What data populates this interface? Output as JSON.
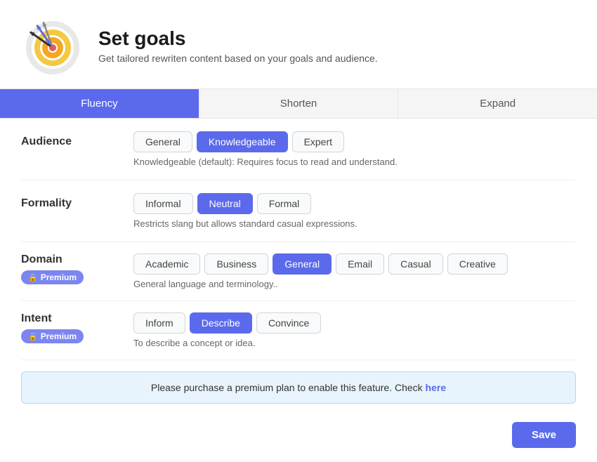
{
  "header": {
    "title": "Set goals",
    "subtitle": "Get tailored rewriten content based on your goals and audience."
  },
  "tabs": [
    {
      "id": "fluency",
      "label": "Fluency",
      "active": true
    },
    {
      "id": "shorten",
      "label": "Shorten",
      "active": false
    },
    {
      "id": "expand",
      "label": "Expand",
      "active": false
    }
  ],
  "sections": {
    "audience": {
      "label": "Audience",
      "options": [
        "General",
        "Knowledgeable",
        "Expert"
      ],
      "active": "Knowledgeable",
      "description": "Knowledgeable (default): Requires focus to read and understand."
    },
    "formality": {
      "label": "Formality",
      "options": [
        "Informal",
        "Neutral",
        "Formal"
      ],
      "active": "Neutral",
      "description": "Restricts slang but allows standard casual expressions."
    },
    "domain": {
      "label": "Domain",
      "premium_label": "Premium",
      "options": [
        "Academic",
        "Business",
        "General",
        "Email",
        "Casual",
        "Creative"
      ],
      "active": "General",
      "description": "General language and terminology.."
    },
    "intent": {
      "label": "Intent",
      "premium_label": "Premium",
      "options": [
        "Inform",
        "Describe",
        "Convince"
      ],
      "active": "Describe",
      "description": "To describe a concept or idea."
    }
  },
  "premium_notice": {
    "text": "Please purchase a premium plan to enable this feature. Check",
    "link_text": "here"
  },
  "save_button": "Save"
}
